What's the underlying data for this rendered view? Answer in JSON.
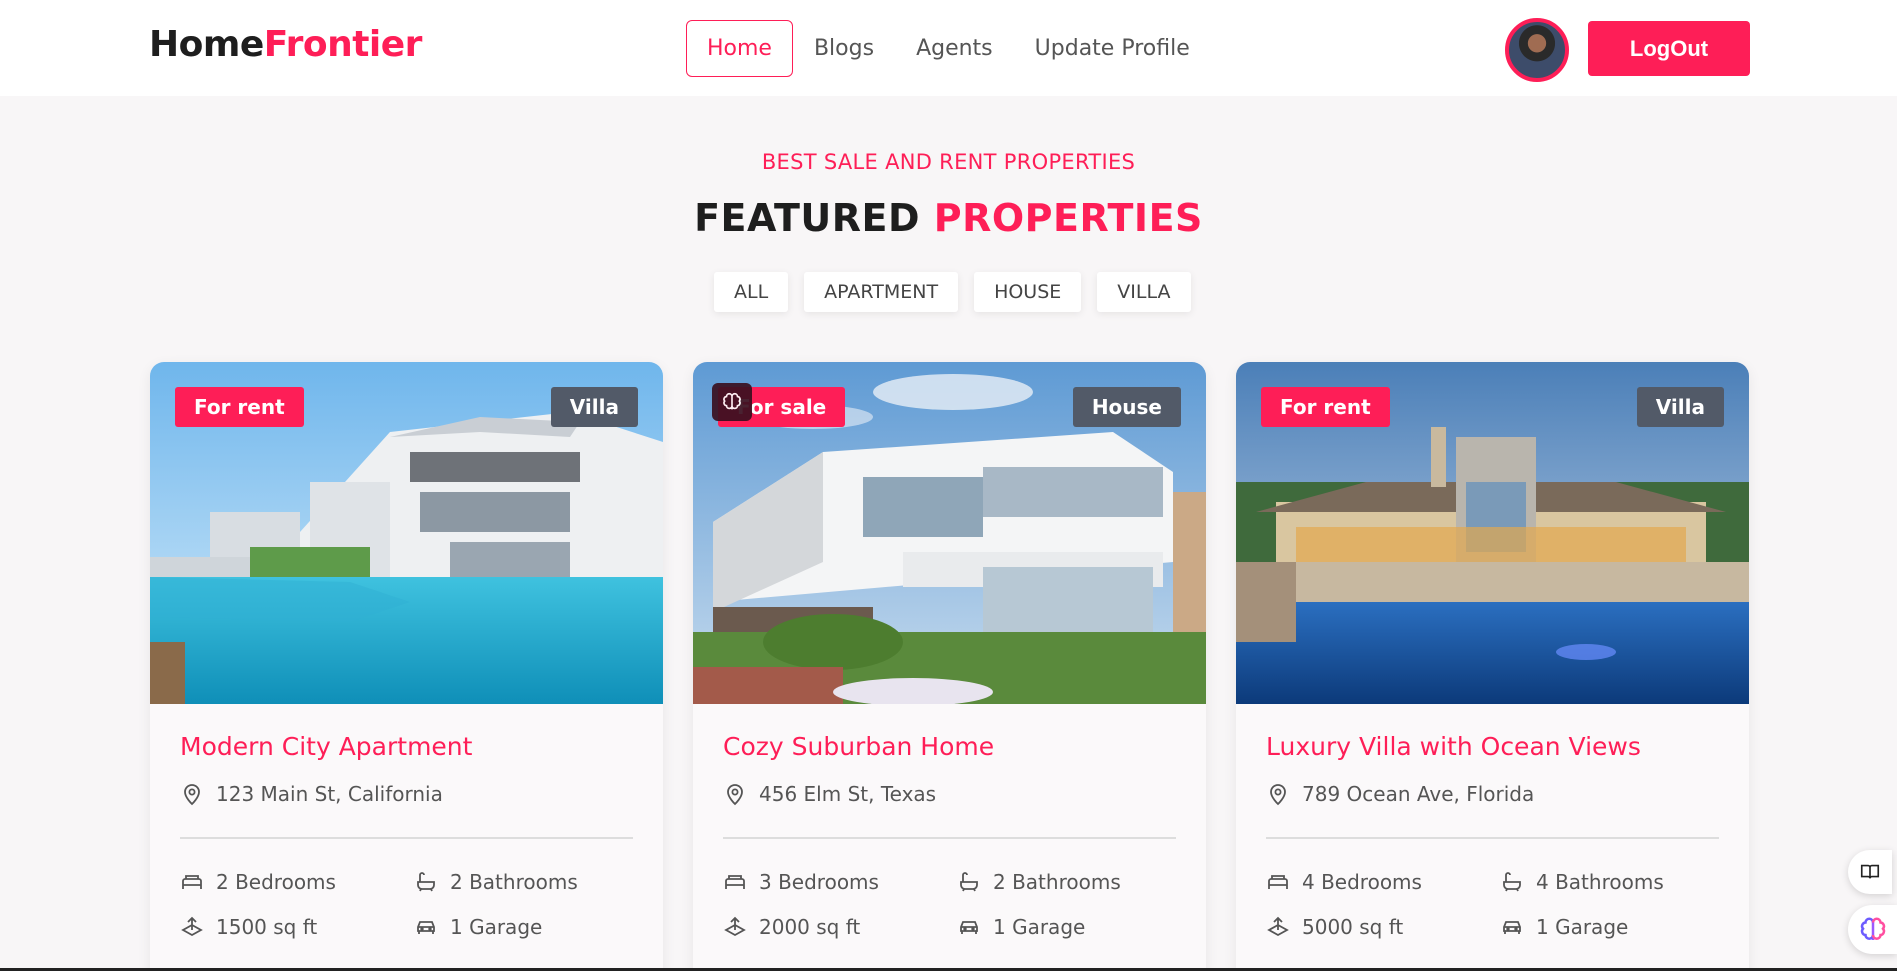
{
  "nav": {
    "logo_part1": "Home",
    "logo_part2": "Frontier",
    "links": [
      "Home",
      "Blogs",
      "Agents",
      "Update Profile"
    ],
    "active_link": "Home",
    "logout_label": "LogOut"
  },
  "section": {
    "kicker": "BEST SALE AND RENT PROPERTIES",
    "title_part1": "FEATURED",
    "title_part2": "PROPERTIES",
    "filters": [
      "ALL",
      "APARTMENT",
      "HOUSE",
      "VILLA"
    ]
  },
  "properties": [
    {
      "status": "For rent",
      "type": "Villa",
      "name": "Modern City Apartment",
      "address": "123 Main St, California",
      "bedrooms": "2 Bedrooms",
      "bathrooms": "2 Bathrooms",
      "area": "1500 sq ft",
      "garage": "1 Garage"
    },
    {
      "status": "For sale",
      "type": "House",
      "name": "Cozy Suburban Home",
      "address": "456 Elm St, Texas",
      "bedrooms": "3 Bedrooms",
      "bathrooms": "2 Bathrooms",
      "area": "2000 sq ft",
      "garage": "1 Garage"
    },
    {
      "status": "For rent",
      "type": "Villa",
      "name": "Luxury Villa with Ocean Views",
      "address": "789 Ocean Ave, Florida",
      "bedrooms": "4 Bedrooms",
      "bathrooms": "4 Bathrooms",
      "area": "5000 sq ft",
      "garage": "1 Garage"
    }
  ],
  "colors": {
    "accent": "#fe1e57",
    "type_badge": "#525a68",
    "background": "#f8f6f7"
  },
  "icons": [
    "location-pin-icon",
    "bed-icon",
    "bathtub-icon",
    "area-icon",
    "car-icon",
    "book-icon",
    "brain-icon"
  ]
}
